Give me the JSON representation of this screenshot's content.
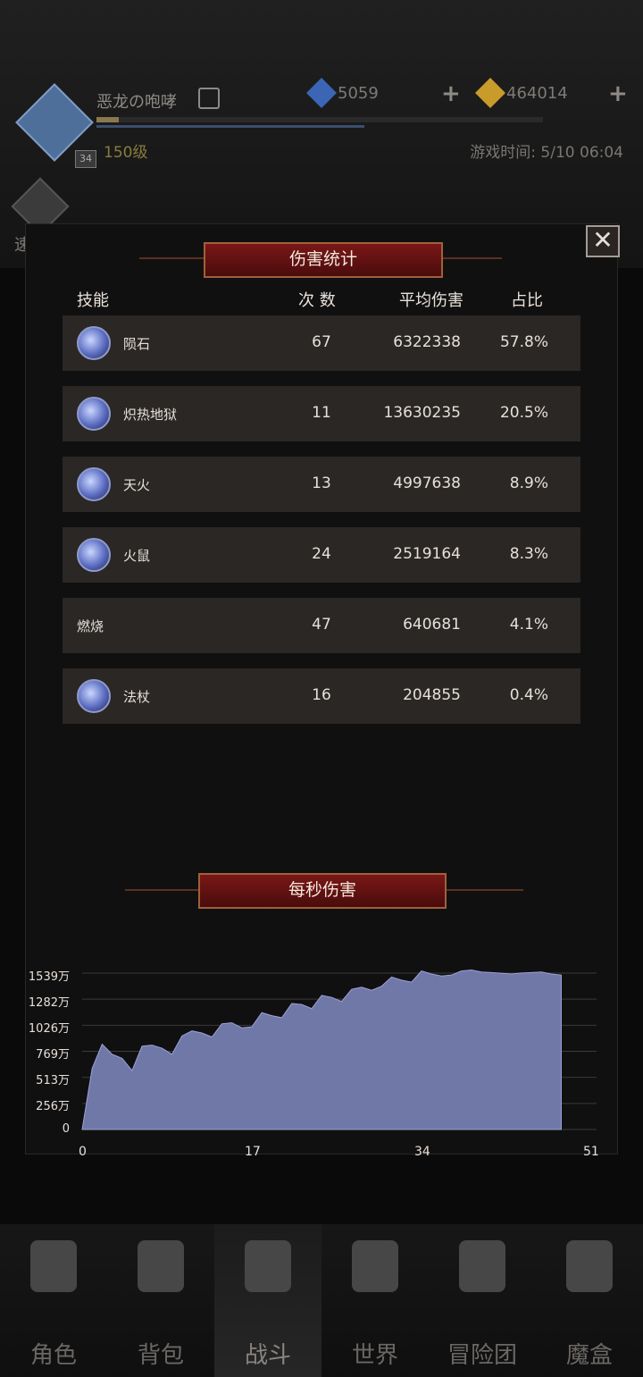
{
  "header": {
    "player_name": "恶龙の咆哮",
    "avatar_level_badge": "34",
    "player_level": "150级",
    "game_time": "游戏时间: 5/10 06:04",
    "quick_battle_label": "速战"
  },
  "currencies": {
    "diamond": "5059",
    "gold": "464014",
    "plus": "+"
  },
  "modal": {
    "close_glyph": "✕",
    "damage_title": "伤害统计",
    "col_skill": "技能",
    "col_count": "次 数",
    "col_avg": "平均伤害",
    "col_ratio": "占比",
    "rows": [
      {
        "name": "陨石",
        "count": "67",
        "avg": "6322338",
        "pct": "57.8%",
        "icon": "meteor-icon"
      },
      {
        "name": "炽热地狱",
        "count": "11",
        "avg": "13630235",
        "pct": "20.5%",
        "icon": "inferno-icon"
      },
      {
        "name": "天火",
        "count": "13",
        "avg": "4997638",
        "pct": "8.9%",
        "icon": "sky-fire-icon"
      },
      {
        "name": "火鼠",
        "count": "24",
        "avg": "2519164",
        "pct": "8.3%",
        "icon": "fire-rat-icon"
      },
      {
        "name": "燃烧",
        "count": "47",
        "avg": "640681",
        "pct": "4.1%",
        "icon": ""
      },
      {
        "name": "法杖",
        "count": "16",
        "avg": "204855",
        "pct": "0.4%",
        "icon": "staff-icon"
      }
    ],
    "dps_title": "每秒伤害"
  },
  "chart_data": {
    "type": "area",
    "title": "每秒伤害",
    "y_tick_labels": [
      "1539万",
      "1282万",
      "1026万",
      "769万",
      "513万",
      "256万",
      "0"
    ],
    "x_tick_labels": [
      "0",
      "17",
      "34",
      "51"
    ],
    "xlim": [
      0,
      51
    ],
    "ylim": [
      0,
      1539
    ],
    "x": [
      0,
      1,
      2,
      3,
      4,
      5,
      6,
      7,
      8,
      9,
      10,
      11,
      12,
      13,
      14,
      15,
      16,
      17,
      18,
      19,
      20,
      21,
      22,
      23,
      24,
      25,
      26,
      27,
      28,
      29,
      30,
      31,
      32,
      33,
      34,
      35,
      36,
      37,
      38,
      39,
      40,
      41,
      42,
      43,
      44,
      45,
      46,
      47,
      48
    ],
    "values": [
      0,
      600,
      840,
      740,
      700,
      580,
      820,
      830,
      800,
      740,
      920,
      970,
      950,
      910,
      1040,
      1050,
      1000,
      1010,
      1150,
      1120,
      1100,
      1240,
      1230,
      1190,
      1320,
      1300,
      1260,
      1380,
      1400,
      1370,
      1410,
      1500,
      1470,
      1450,
      1560,
      1530,
      1510,
      1520,
      1560,
      1570,
      1550,
      1545,
      1538,
      1530,
      1540,
      1545,
      1550,
      1530,
      1520
    ],
    "fill_color": "#7078a8",
    "grid": true
  },
  "nav": {
    "items": [
      {
        "label": "角色",
        "icon": "helmet-icon"
      },
      {
        "label": "背包",
        "icon": "backpack-icon"
      },
      {
        "label": "战斗",
        "icon": "sword-shield-icon"
      },
      {
        "label": "世界",
        "icon": "map-scroll-icon"
      },
      {
        "label": "冒险团",
        "icon": "castle-icon"
      },
      {
        "label": "魔盒",
        "icon": "magic-box-icon"
      }
    ],
    "active_index": 2
  }
}
